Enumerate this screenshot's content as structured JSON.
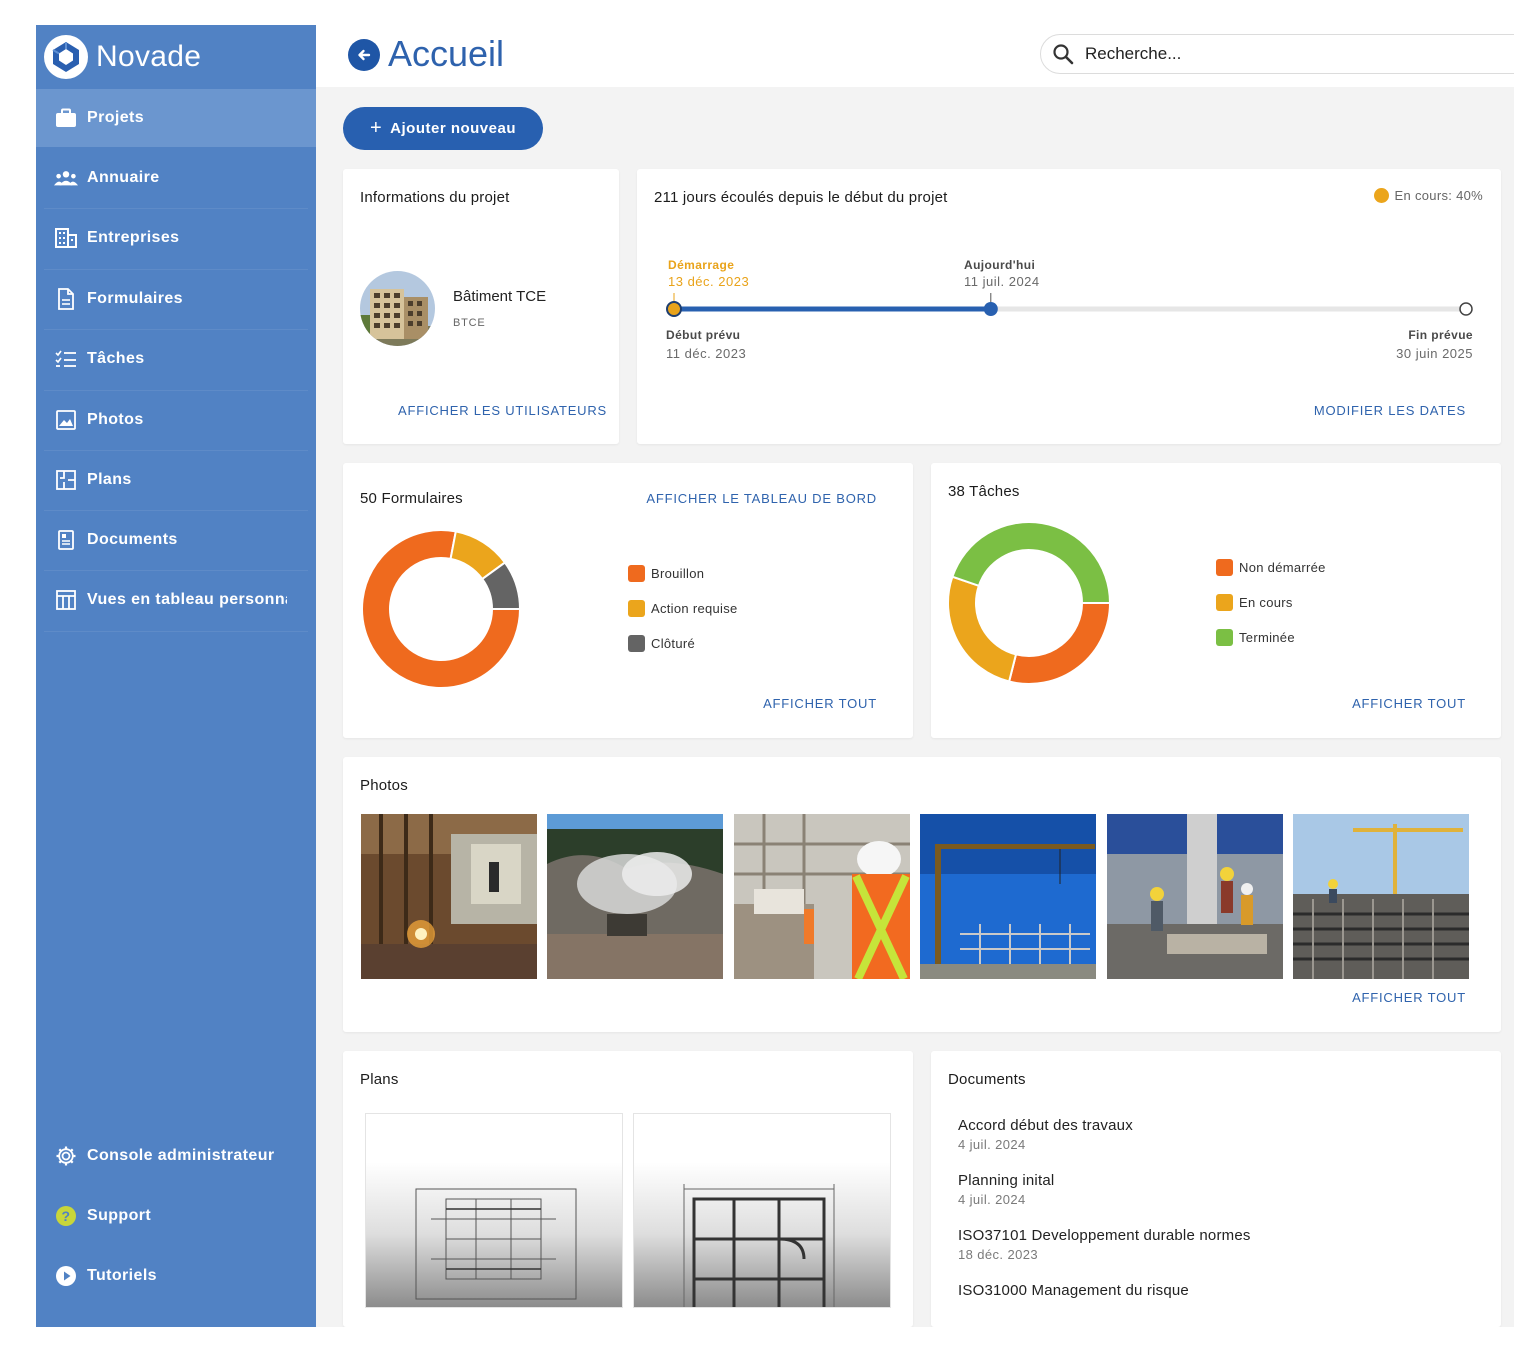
{
  "app": {
    "name": "Novade"
  },
  "sidebar": {
    "items": [
      {
        "label": "Projets"
      },
      {
        "label": "Annuaire"
      },
      {
        "label": "Entreprises"
      },
      {
        "label": "Formulaires"
      },
      {
        "label": "Tâches"
      },
      {
        "label": "Photos"
      },
      {
        "label": "Plans"
      },
      {
        "label": "Documents"
      },
      {
        "label": "Vues en tableau personna"
      }
    ],
    "bottom_items": [
      {
        "label": "Console administrateur"
      },
      {
        "label": "Support"
      },
      {
        "label": "Tutoriels"
      }
    ]
  },
  "header": {
    "title": "Accueil",
    "search_placeholder": "Recherche..."
  },
  "add_button": {
    "label": "Ajouter nouveau"
  },
  "project_info": {
    "title": "Informations du projet",
    "project_name": "Bâtiment TCE",
    "project_code": "BTCE",
    "link": "AFFICHER LES UTILISATEURS"
  },
  "timeline": {
    "title": "211 jours écoulés depuis le début du projet",
    "status": "En cours: 40%",
    "progress": 0.4,
    "start_label": "Démarrage",
    "start_date": "13 déc. 2023",
    "today_label": "Aujourd'hui",
    "today_date": "11 juil. 2024",
    "planned_start_label": "Début prévu",
    "planned_start_date": "11 déc. 2023",
    "planned_end_label": "Fin prévue",
    "planned_end_date": "30 juin 2025",
    "link": "MODIFIER LES DATES",
    "colors": {
      "start": "#e9a31a",
      "bar": "#2860b0",
      "track": "#e8e8e8"
    }
  },
  "forms": {
    "title": "50 Formulaires",
    "dashboard_link": "AFFICHER LE TABLEAU DE BORD",
    "link": "AFFICHER TOUT",
    "legend": [
      {
        "label": "Brouillon",
        "color": "#ef6a1e"
      },
      {
        "label": "Action requise",
        "color": "#eba51c"
      },
      {
        "label": "Clôturé",
        "color": "#646464"
      }
    ]
  },
  "tasks": {
    "title": "38 Tâches",
    "link": "AFFICHER TOUT",
    "legend": [
      {
        "label": "Non démarrée",
        "color": "#ef6a1e"
      },
      {
        "label": "En cours",
        "color": "#eba51c"
      },
      {
        "label": "Terminée",
        "color": "#7bbf44"
      }
    ]
  },
  "photos": {
    "title": "Photos",
    "link": "AFFICHER TOUT"
  },
  "plans": {
    "title": "Plans"
  },
  "documents": {
    "title": "Documents",
    "items": [
      {
        "name": "Accord début des travaux",
        "date": "4 juil. 2024"
      },
      {
        "name": "Planning inital",
        "date": "4 juil. 2024"
      },
      {
        "name": "ISO37101 Developpement durable normes",
        "date": "18 déc. 2023"
      },
      {
        "name": "ISO31000 Management du risque",
        "date": ""
      }
    ]
  },
  "chart_data": [
    {
      "type": "pie",
      "categories": [
        "Brouillon",
        "Action requise",
        "Clôturé"
      ],
      "values": [
        39,
        6,
        5
      ],
      "donut": true
    },
    {
      "type": "pie",
      "categories": [
        "Non démarrée",
        "En cours",
        "Terminée"
      ],
      "values": [
        11,
        10,
        17
      ],
      "donut": true
    }
  ]
}
